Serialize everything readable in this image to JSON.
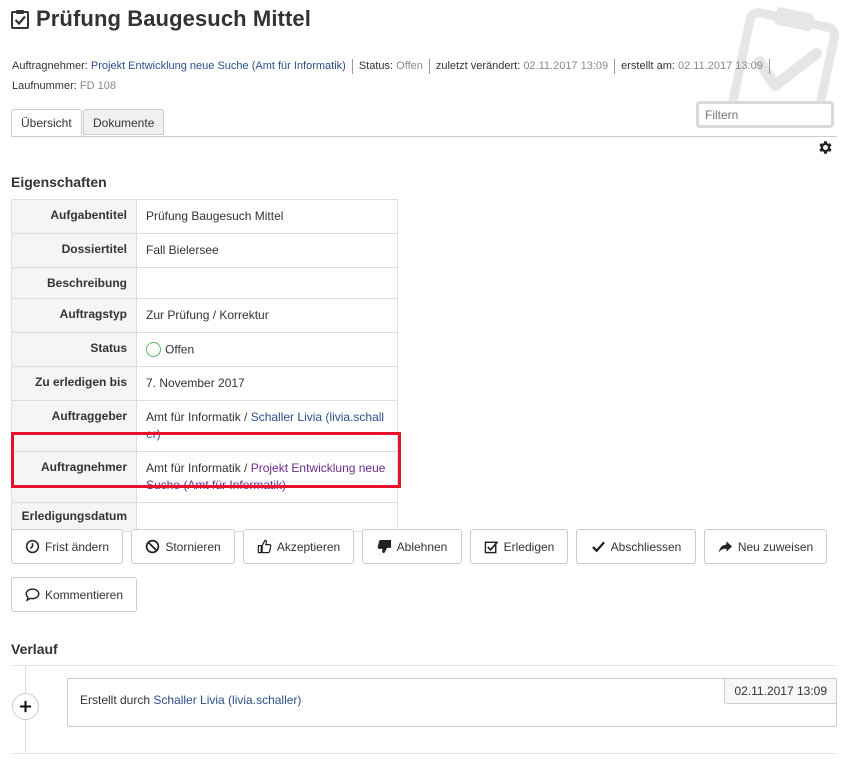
{
  "page": {
    "title": "Prüfung Baugesuch Mittel"
  },
  "meta": {
    "auftragnehmer_label": "Auftragnehmer:",
    "auftragnehmer_value": "Projekt Entwicklung neue Suche (Amt für Informatik)",
    "status_label": "Status:",
    "status_value": "Offen",
    "modified_label": "zuletzt verändert:",
    "modified_value": "02.11.2017 13:09",
    "created_label": "erstellt am:",
    "created_value": "02.11.2017 13:09",
    "laufnummer_label": "Laufnummer:",
    "laufnummer_value": "FD 108"
  },
  "filter": {
    "placeholder": "Filtern"
  },
  "tabs": [
    {
      "label": "Übersicht"
    },
    {
      "label": "Dokumente"
    }
  ],
  "properties": {
    "title": "Eigenschaften",
    "rows": {
      "aufgabentitel": {
        "key": "Aufgabentitel",
        "value": "Prüfung Baugesuch Mittel"
      },
      "dossiertitel": {
        "key": "Dossiertitel",
        "value": "Fall Bielersee"
      },
      "beschreibung": {
        "key": "Beschreibung",
        "value": ""
      },
      "auftragstyp": {
        "key": "Auftragstyp",
        "value": "Zur Prüfung / Korrektur"
      },
      "status": {
        "key": "Status",
        "value": "Offen"
      },
      "zu_erledigen": {
        "key": "Zu erledigen bis",
        "value": "7. November 2017"
      },
      "auftraggeber": {
        "key": "Auftraggeber",
        "prefix": "Amt für Informatik / ",
        "link_line1": "Schaller Livia (livia.schall",
        "link_line2": "er)"
      },
      "auftragnehmer": {
        "key": "Auftragnehmer",
        "prefix": "Amt für Informatik / ",
        "link_line1": "Projekt Entwicklung neue",
        "link_line2": "Suche (Amt für Informatik)"
      },
      "erledigungsdatum": {
        "key": "Erledigungsdatum",
        "value": ""
      }
    }
  },
  "actions": {
    "frist": "Frist ändern",
    "stornieren": "Stornieren",
    "akzeptieren": "Akzeptieren",
    "ablehnen": "Ablehnen",
    "erledigen": "Erledigen",
    "abschliessen": "Abschliessen",
    "neu_zuweisen": "Neu zuweisen",
    "kommentieren": "Kommentieren"
  },
  "history": {
    "title": "Verlauf",
    "entries": [
      {
        "text": "Erstellt durch ",
        "user": "Schaller Livia (livia.schaller)",
        "date": "02.11.2017 13:09"
      }
    ]
  },
  "colors": {
    "link": "#2c4f8a",
    "visited_link": "#6e2a8f",
    "status_ok": "#5cb85c",
    "highlight": "#e8102a"
  }
}
